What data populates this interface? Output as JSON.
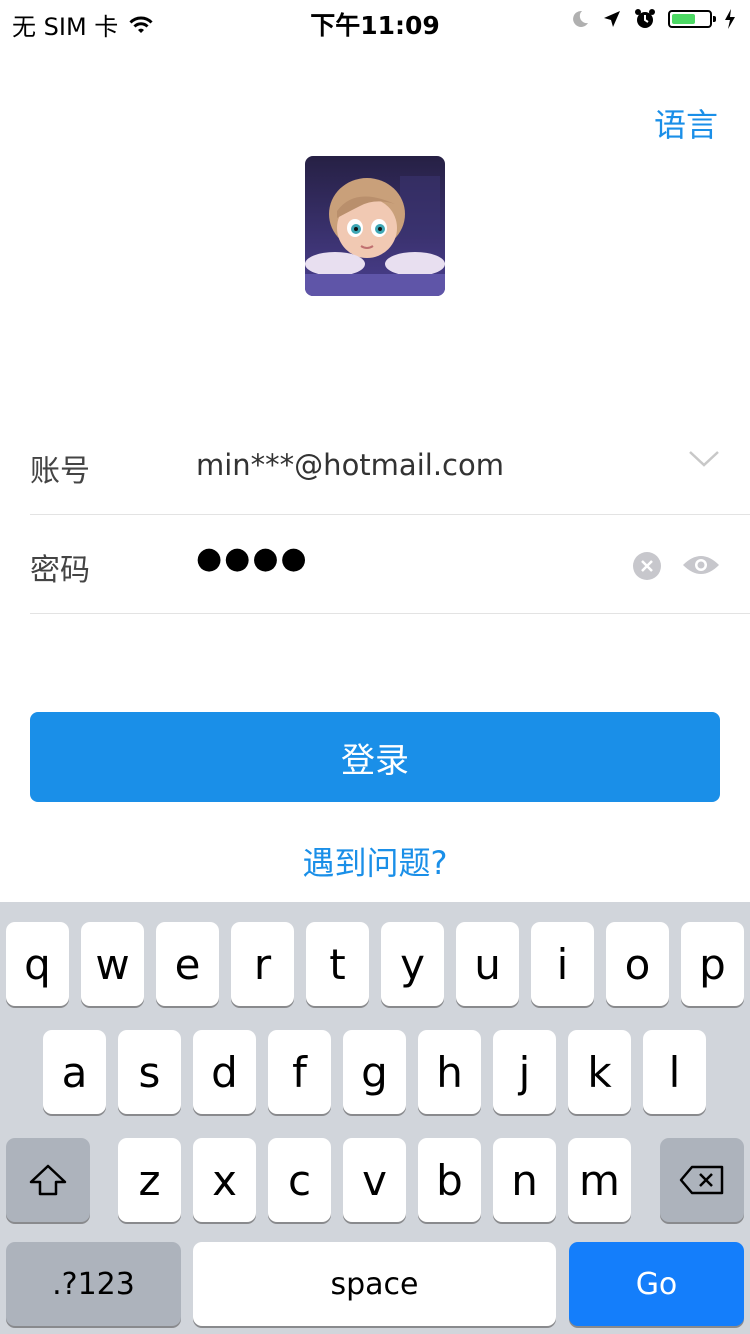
{
  "status_bar": {
    "carrier": "无 SIM 卡",
    "time": "下午11:09",
    "battery_level": 0.65,
    "battery_color": "#4cd964",
    "icons": [
      "wifi-icon",
      "moon-icon",
      "location-icon",
      "alarm-icon",
      "battery-icon",
      "charging-icon"
    ]
  },
  "header": {
    "language_link": "语言"
  },
  "form": {
    "account_label": "账号",
    "account_value": "min***@hotmail.com",
    "password_label": "密码",
    "password_masked": "●●●●"
  },
  "actions": {
    "login_button": "登录",
    "help_link": "遇到问题?"
  },
  "keyboard": {
    "row1": [
      "q",
      "w",
      "e",
      "r",
      "t",
      "y",
      "u",
      "i",
      "o",
      "p"
    ],
    "row2": [
      "a",
      "s",
      "d",
      "f",
      "g",
      "h",
      "j",
      "k",
      "l"
    ],
    "row3": [
      "z",
      "x",
      "c",
      "v",
      "b",
      "n",
      "m"
    ],
    "numbers_key": ".?123",
    "space_key": "space",
    "go_key": "Go"
  },
  "colors": {
    "accent": "#1a8fe8",
    "keyboard_bg": "#d1d5db",
    "go_key": "#147efb"
  }
}
